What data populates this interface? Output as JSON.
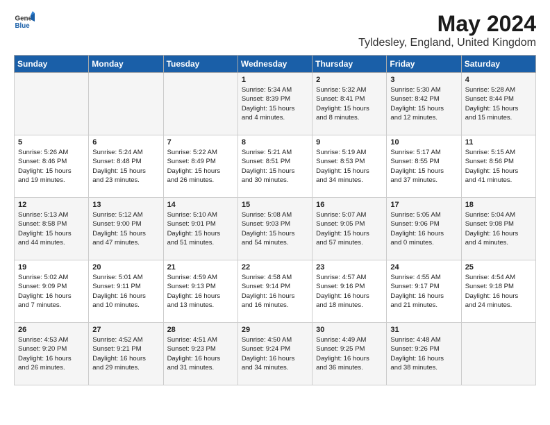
{
  "header": {
    "logo": {
      "general": "General",
      "blue": "Blue"
    },
    "title": "May 2024",
    "location": "Tyldesley, England, United Kingdom"
  },
  "weekdays": [
    "Sunday",
    "Monday",
    "Tuesday",
    "Wednesday",
    "Thursday",
    "Friday",
    "Saturday"
  ],
  "weeks": [
    [
      {
        "day": "",
        "info": ""
      },
      {
        "day": "",
        "info": ""
      },
      {
        "day": "",
        "info": ""
      },
      {
        "day": "1",
        "info": "Sunrise: 5:34 AM\nSunset: 8:39 PM\nDaylight: 15 hours\nand 4 minutes."
      },
      {
        "day": "2",
        "info": "Sunrise: 5:32 AM\nSunset: 8:41 PM\nDaylight: 15 hours\nand 8 minutes."
      },
      {
        "day": "3",
        "info": "Sunrise: 5:30 AM\nSunset: 8:42 PM\nDaylight: 15 hours\nand 12 minutes."
      },
      {
        "day": "4",
        "info": "Sunrise: 5:28 AM\nSunset: 8:44 PM\nDaylight: 15 hours\nand 15 minutes."
      }
    ],
    [
      {
        "day": "5",
        "info": "Sunrise: 5:26 AM\nSunset: 8:46 PM\nDaylight: 15 hours\nand 19 minutes."
      },
      {
        "day": "6",
        "info": "Sunrise: 5:24 AM\nSunset: 8:48 PM\nDaylight: 15 hours\nand 23 minutes."
      },
      {
        "day": "7",
        "info": "Sunrise: 5:22 AM\nSunset: 8:49 PM\nDaylight: 15 hours\nand 26 minutes."
      },
      {
        "day": "8",
        "info": "Sunrise: 5:21 AM\nSunset: 8:51 PM\nDaylight: 15 hours\nand 30 minutes."
      },
      {
        "day": "9",
        "info": "Sunrise: 5:19 AM\nSunset: 8:53 PM\nDaylight: 15 hours\nand 34 minutes."
      },
      {
        "day": "10",
        "info": "Sunrise: 5:17 AM\nSunset: 8:55 PM\nDaylight: 15 hours\nand 37 minutes."
      },
      {
        "day": "11",
        "info": "Sunrise: 5:15 AM\nSunset: 8:56 PM\nDaylight: 15 hours\nand 41 minutes."
      }
    ],
    [
      {
        "day": "12",
        "info": "Sunrise: 5:13 AM\nSunset: 8:58 PM\nDaylight: 15 hours\nand 44 minutes."
      },
      {
        "day": "13",
        "info": "Sunrise: 5:12 AM\nSunset: 9:00 PM\nDaylight: 15 hours\nand 47 minutes."
      },
      {
        "day": "14",
        "info": "Sunrise: 5:10 AM\nSunset: 9:01 PM\nDaylight: 15 hours\nand 51 minutes."
      },
      {
        "day": "15",
        "info": "Sunrise: 5:08 AM\nSunset: 9:03 PM\nDaylight: 15 hours\nand 54 minutes."
      },
      {
        "day": "16",
        "info": "Sunrise: 5:07 AM\nSunset: 9:05 PM\nDaylight: 15 hours\nand 57 minutes."
      },
      {
        "day": "17",
        "info": "Sunrise: 5:05 AM\nSunset: 9:06 PM\nDaylight: 16 hours\nand 0 minutes."
      },
      {
        "day": "18",
        "info": "Sunrise: 5:04 AM\nSunset: 9:08 PM\nDaylight: 16 hours\nand 4 minutes."
      }
    ],
    [
      {
        "day": "19",
        "info": "Sunrise: 5:02 AM\nSunset: 9:09 PM\nDaylight: 16 hours\nand 7 minutes."
      },
      {
        "day": "20",
        "info": "Sunrise: 5:01 AM\nSunset: 9:11 PM\nDaylight: 16 hours\nand 10 minutes."
      },
      {
        "day": "21",
        "info": "Sunrise: 4:59 AM\nSunset: 9:13 PM\nDaylight: 16 hours\nand 13 minutes."
      },
      {
        "day": "22",
        "info": "Sunrise: 4:58 AM\nSunset: 9:14 PM\nDaylight: 16 hours\nand 16 minutes."
      },
      {
        "day": "23",
        "info": "Sunrise: 4:57 AM\nSunset: 9:16 PM\nDaylight: 16 hours\nand 18 minutes."
      },
      {
        "day": "24",
        "info": "Sunrise: 4:55 AM\nSunset: 9:17 PM\nDaylight: 16 hours\nand 21 minutes."
      },
      {
        "day": "25",
        "info": "Sunrise: 4:54 AM\nSunset: 9:18 PM\nDaylight: 16 hours\nand 24 minutes."
      }
    ],
    [
      {
        "day": "26",
        "info": "Sunrise: 4:53 AM\nSunset: 9:20 PM\nDaylight: 16 hours\nand 26 minutes."
      },
      {
        "day": "27",
        "info": "Sunrise: 4:52 AM\nSunset: 9:21 PM\nDaylight: 16 hours\nand 29 minutes."
      },
      {
        "day": "28",
        "info": "Sunrise: 4:51 AM\nSunset: 9:23 PM\nDaylight: 16 hours\nand 31 minutes."
      },
      {
        "day": "29",
        "info": "Sunrise: 4:50 AM\nSunset: 9:24 PM\nDaylight: 16 hours\nand 34 minutes."
      },
      {
        "day": "30",
        "info": "Sunrise: 4:49 AM\nSunset: 9:25 PM\nDaylight: 16 hours\nand 36 minutes."
      },
      {
        "day": "31",
        "info": "Sunrise: 4:48 AM\nSunset: 9:26 PM\nDaylight: 16 hours\nand 38 minutes."
      },
      {
        "day": "",
        "info": ""
      }
    ]
  ]
}
